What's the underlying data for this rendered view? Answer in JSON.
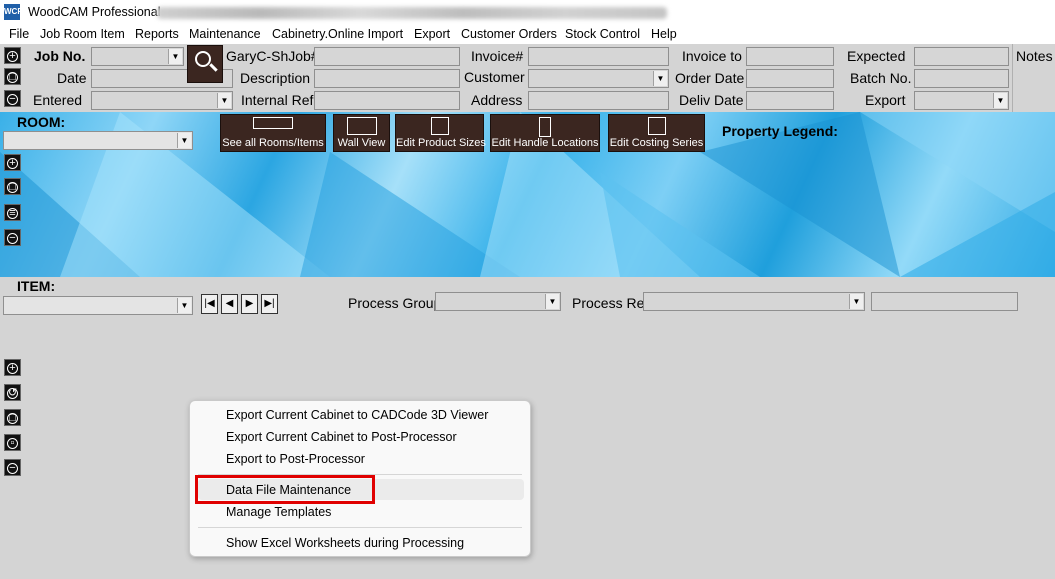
{
  "window": {
    "title": "WoodCAM Professional",
    "logo_text": "WCP"
  },
  "menu": [
    "File",
    "Job Room Item",
    "Reports",
    "Maintenance",
    "Cabinetry.Online Import",
    "Export",
    "Customer Orders",
    "Stock Control",
    "Help"
  ],
  "header": {
    "job_no_label": "Job No.",
    "date_label": "Date",
    "entered_label": "Entered",
    "job_ref_label": "GaryC-ShJob#",
    "description_label": "Description",
    "internal_ref_label": "Internal Ref",
    "invoice_label": "Invoice#",
    "customer_label": "Customer",
    "address_label": "Address",
    "invoice_to_label": "Invoice to",
    "order_date_label": "Order Date",
    "deliv_date_label": "Deliv Date",
    "expected_label": "Expected",
    "batch_no_label": "Batch No.",
    "export_label": "Export",
    "notes_label": "Notes"
  },
  "room": {
    "label": "ROOM:",
    "buttons": [
      "See all Rooms/Items",
      "Wall View",
      "Edit Product Sizes",
      "Edit Handle Locations",
      "Edit Costing Series"
    ],
    "property_legend": "Property Legend:"
  },
  "item": {
    "label": "ITEM:",
    "process_group_label": "Process Group",
    "process_ref_label": "Process Ref",
    "nav": [
      "|◀",
      "◀",
      "▶",
      "▶|"
    ]
  },
  "context_menu": {
    "items": [
      "Export Current Cabinet to CADCode 3D Viewer",
      "Export Current Cabinet to Post-Processor",
      "Export to Post-Processor",
      "Data File Maintenance",
      "Manage Templates",
      "Show Excel Worksheets during Processing"
    ],
    "highlighted": "Data File Maintenance"
  },
  "colors": {
    "highlight": "#e00000",
    "room_bg": "#2ba6e2",
    "dark_button": "#3b2620"
  }
}
